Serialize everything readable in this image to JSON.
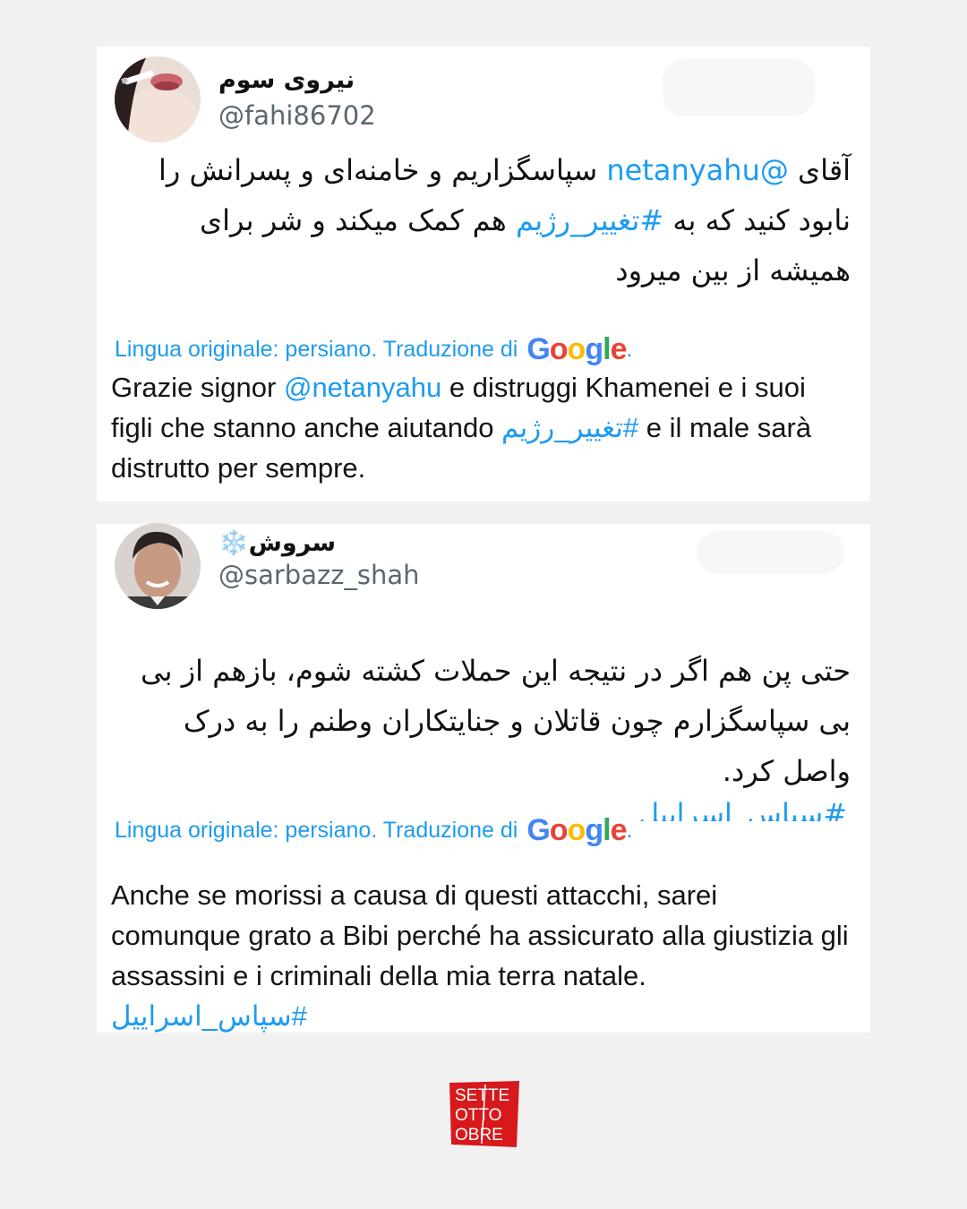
{
  "tweets": [
    {
      "display_name": "نیروی سوم",
      "handle": "@fahi86702",
      "text_parts": [
        "آقای ",
        "@netanyahu",
        " سپاسگزاریم و خامنه‌ای و پسرانش را نابود کنید که به ",
        "#تغییر_رژیم",
        " هم کمک میکند و شر برای همیشه از بین میرود"
      ],
      "translation_note": "Lingua originale: persiano. Traduzione di",
      "translation_parts": [
        "Grazie signor ",
        "@netanyahu",
        " e distruggi Khamenei e i suoi figli che stanno anche aiutando ",
        "#تغییر_رژیم",
        " e il male sarà distrutto per sempre."
      ]
    },
    {
      "display_name": "سروش",
      "name_emoji": "❄️",
      "handle": "@sarbazz_shah",
      "text": "حتی پن هم اگر در نتیجه این حملات کشته شوم، بازهم از بی بی سپاسگزارم چون قاتلان و جنایتکاران وطنم را به درک واصل کرد.",
      "hashtag": "#سپاس_اسراییل",
      "translation_note": "Lingua originale: persiano. Traduzione di",
      "translation_text": "Anche se morissi a causa di questi attacchi, sarei comunque grato a Bibi perché ha assicurato alla giustizia gli assassini e i criminali della mia terra natale.",
      "translation_hashtag": "#سپاس_اسراییل"
    }
  ],
  "google_logo": [
    "G",
    "o",
    "o",
    "g",
    "l",
    "e"
  ],
  "google_colors": [
    "#4285F4",
    "#EA4335",
    "#FBBC05",
    "#4285F4",
    "#34A853",
    "#EA4335"
  ],
  "translation_period": ".",
  "brand_logo": {
    "lines": [
      "SETTE",
      "OTTO",
      "OBRE"
    ],
    "color": "#d7191c"
  },
  "colors": {
    "link": "#1d9bf0",
    "background": "#f1f1f1",
    "card": "#ffffff"
  }
}
